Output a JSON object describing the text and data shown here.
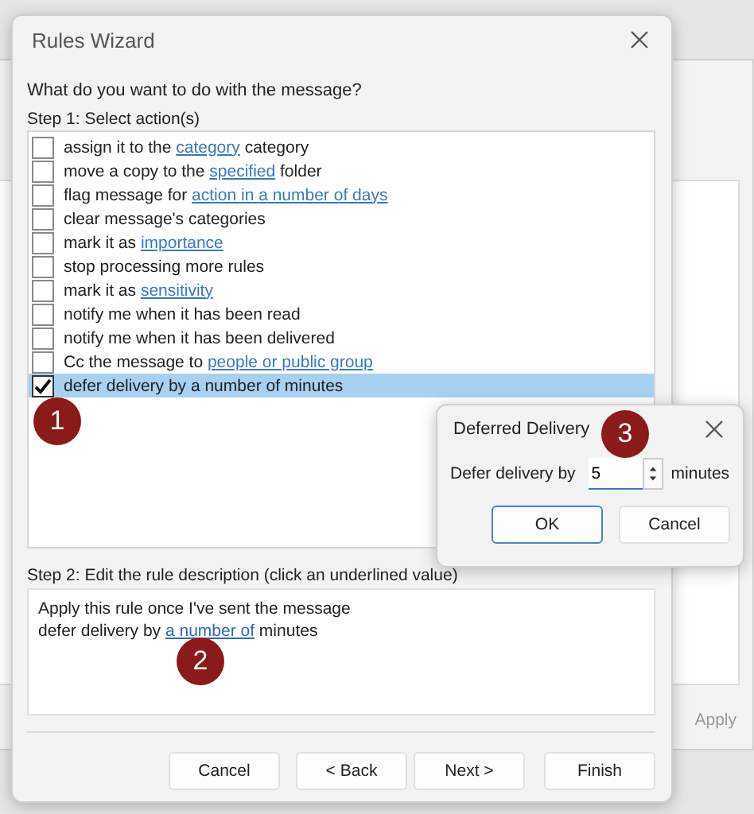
{
  "background_window": {
    "apply_button": "Apply"
  },
  "dialog": {
    "title": "Rules Wizard",
    "question": "What do you want to do with the message?",
    "step1_label": "Step 1: Select action(s)",
    "actions": [
      {
        "checked": false,
        "selected": false,
        "parts": [
          {
            "kind": "text",
            "text": "assign it to the "
          },
          {
            "kind": "link",
            "text": "category"
          },
          {
            "kind": "text",
            "text": " category"
          }
        ]
      },
      {
        "checked": false,
        "selected": false,
        "parts": [
          {
            "kind": "text",
            "text": "move a copy to the "
          },
          {
            "kind": "link",
            "text": "specified"
          },
          {
            "kind": "text",
            "text": " folder"
          }
        ]
      },
      {
        "checked": false,
        "selected": false,
        "parts": [
          {
            "kind": "text",
            "text": "flag message for "
          },
          {
            "kind": "link",
            "text": "action in a number of days"
          }
        ]
      },
      {
        "checked": false,
        "selected": false,
        "parts": [
          {
            "kind": "text",
            "text": "clear message's categories"
          }
        ]
      },
      {
        "checked": false,
        "selected": false,
        "parts": [
          {
            "kind": "text",
            "text": "mark it as "
          },
          {
            "kind": "link",
            "text": "importance"
          }
        ]
      },
      {
        "checked": false,
        "selected": false,
        "parts": [
          {
            "kind": "text",
            "text": "stop processing more rules"
          }
        ]
      },
      {
        "checked": false,
        "selected": false,
        "parts": [
          {
            "kind": "text",
            "text": "mark it as "
          },
          {
            "kind": "link",
            "text": "sensitivity"
          }
        ]
      },
      {
        "checked": false,
        "selected": false,
        "parts": [
          {
            "kind": "text",
            "text": "notify me when it has been read"
          }
        ]
      },
      {
        "checked": false,
        "selected": false,
        "parts": [
          {
            "kind": "text",
            "text": "notify me when it has been delivered"
          }
        ]
      },
      {
        "checked": false,
        "selected": false,
        "parts": [
          {
            "kind": "text",
            "text": "Cc the message to "
          },
          {
            "kind": "link",
            "text": "people or public group"
          }
        ]
      },
      {
        "checked": true,
        "selected": true,
        "parts": [
          {
            "kind": "text",
            "text": "defer delivery by a number of minutes"
          }
        ]
      }
    ],
    "step2_label": "Step 2: Edit the rule description (click an underlined value)",
    "description": [
      [
        {
          "kind": "text",
          "text": "Apply this rule once I've sent the message"
        }
      ],
      [
        {
          "kind": "text",
          "text": "defer delivery by "
        },
        {
          "kind": "link",
          "text": "a number of"
        },
        {
          "kind": "text",
          "text": " minutes"
        }
      ]
    ],
    "buttons": [
      "Cancel",
      "< Back",
      "Next >",
      "Finish"
    ]
  },
  "deferred_dialog": {
    "title": "Deferred Delivery",
    "field_label": "Defer delivery by",
    "value": "5",
    "unit": "minutes",
    "buttons": [
      "OK",
      "Cancel"
    ]
  },
  "callouts": [
    "1",
    "2",
    "3"
  ]
}
